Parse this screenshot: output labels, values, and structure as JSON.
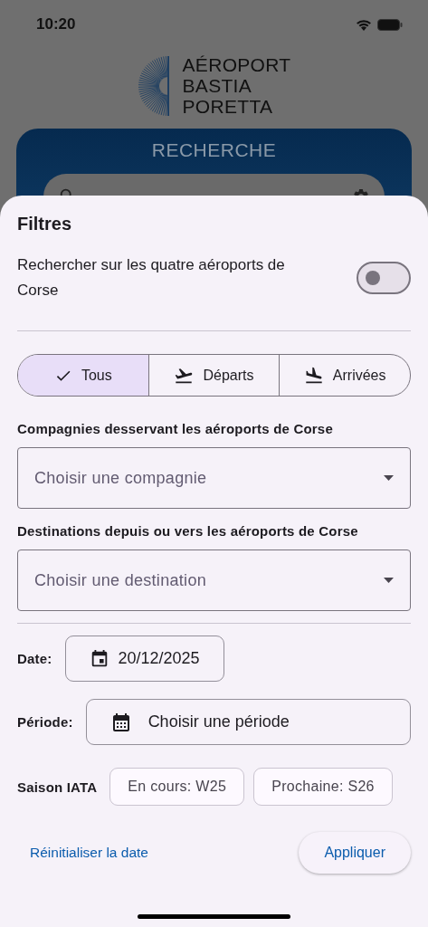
{
  "status_bar": {
    "time": "10:20"
  },
  "header": {
    "logo_lines": [
      "AÉROPORT",
      "BASTIA",
      "PORETTA"
    ]
  },
  "search_card": {
    "title": "RECHERCHE"
  },
  "filters": {
    "title": "Filtres",
    "toggle": {
      "label": "Rechercher sur les quatre aéroports de Corse",
      "on": false
    },
    "segments": [
      {
        "label": "Tous",
        "selected": true
      },
      {
        "label": "Départs",
        "kind": "departures",
        "selected": false
      },
      {
        "label": "Arrivées",
        "kind": "arrivals",
        "selected": false
      }
    ],
    "dropdowns": [
      {
        "label": "Compagnies desservant les aéroports de Corse",
        "placeholder": "Choisir une compagnie"
      },
      {
        "label": "Destinations depuis ou vers les aéroports de Corse",
        "placeholder": "Choisir une destination"
      }
    ],
    "date": {
      "label": "Date:",
      "value": "20/12/2025"
    },
    "period": {
      "label": "Période:",
      "placeholder": "Choisir une période"
    },
    "iata_season": {
      "label": "Saison IATA",
      "chips": [
        "En cours: W25",
        "Prochaine: S26"
      ]
    },
    "actions": {
      "reset": "Réinitialiser la date",
      "apply": "Appliquer"
    }
  }
}
